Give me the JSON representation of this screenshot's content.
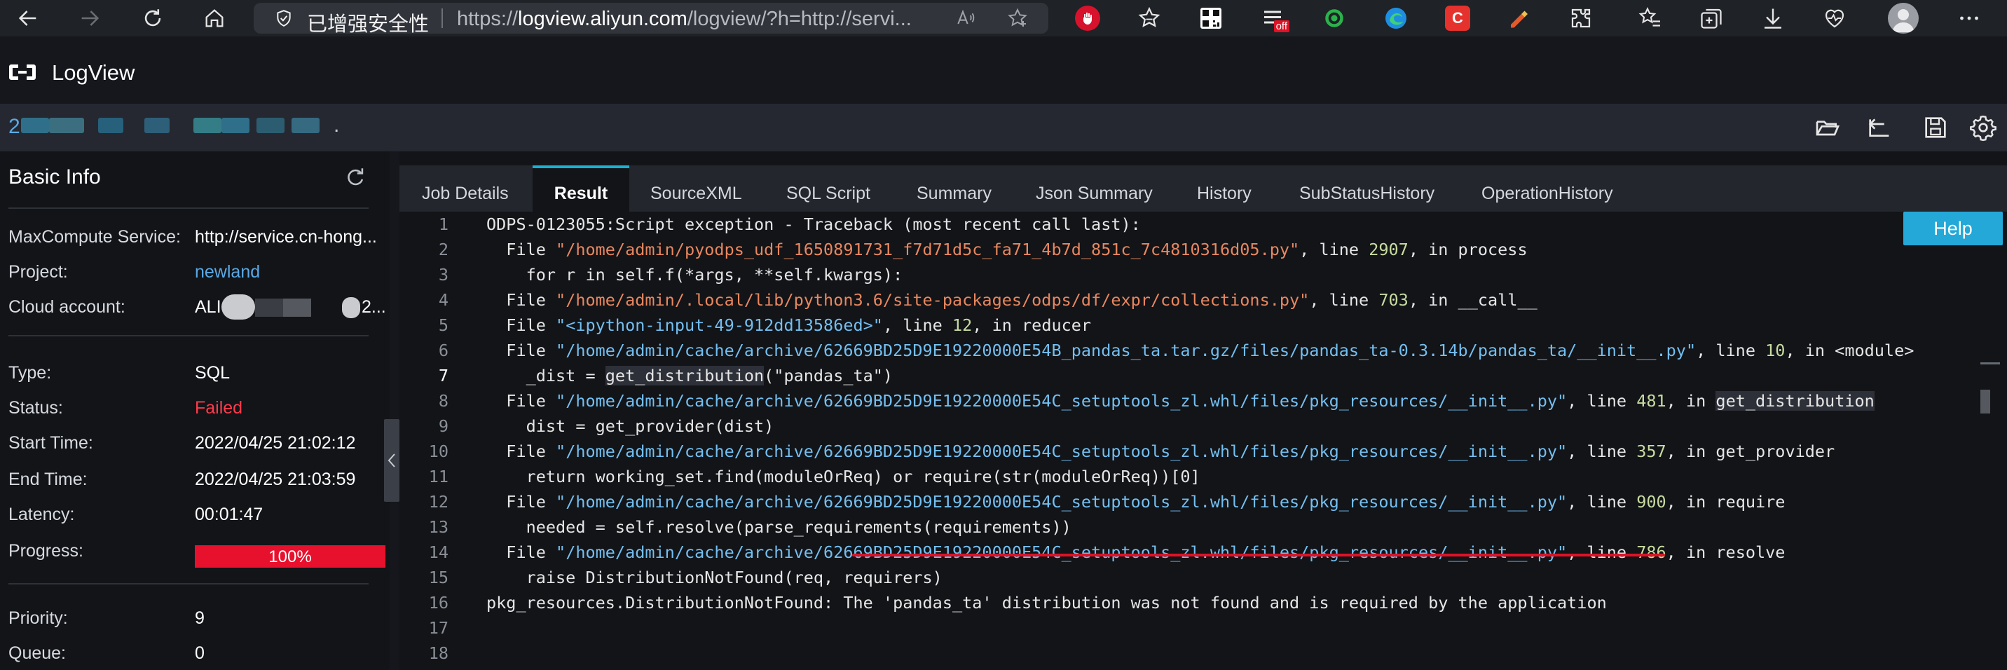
{
  "browser": {
    "security_label": "已增强安全性",
    "url_prefix": "https://",
    "url_domain": "logview.aliyun.com",
    "url_rest": "/logview/?h=http://servi...",
    "ext_badge": "off",
    "ext_c_label": "C"
  },
  "app": {
    "title": "LogView"
  },
  "job": {
    "id_first_char": "2",
    "id_trailing": "."
  },
  "basic_info": {
    "title": "Basic Info",
    "rows": [
      {
        "label": "MaxCompute Service:",
        "value": "http://service.cn-hong..."
      },
      {
        "label": "Project:",
        "value": "newland"
      },
      {
        "label": "Cloud account:",
        "value_prefix": "ALI",
        "value_suffix": "2..."
      },
      {
        "label": "Type:",
        "value": "SQL"
      },
      {
        "label": "Status:",
        "value": "Failed"
      },
      {
        "label": "Start Time:",
        "value": "2022/04/25 21:02:12"
      },
      {
        "label": "End Time:",
        "value": "2022/04/25 21:03:59"
      },
      {
        "label": "Latency:",
        "value": "00:01:47"
      },
      {
        "label": "Progress:",
        "value": "100%"
      },
      {
        "label": "Priority:",
        "value": "9"
      },
      {
        "label": "Queue:",
        "value": "0"
      }
    ],
    "progress": 1.0,
    "colors": {
      "link": "#5aa9e6",
      "failed": "#ff3b4a",
      "progress": "#e8112d"
    }
  },
  "tabs": [
    {
      "label": "Job Details",
      "active": false
    },
    {
      "label": "Result",
      "active": true
    },
    {
      "label": "SourceXML",
      "active": false
    },
    {
      "label": "SQL Script",
      "active": false
    },
    {
      "label": "Summary",
      "active": false
    },
    {
      "label": "Json Summary",
      "active": false
    },
    {
      "label": "History",
      "active": false
    },
    {
      "label": "SubStatusHistory",
      "active": false
    },
    {
      "label": "OperationHistory",
      "active": false
    }
  ],
  "help_label": "Help",
  "result": {
    "current_line": 7,
    "lines": [
      {
        "n": "1",
        "segs": [
          [
            "ODPS-0123055:Script exception - Traceback (most recent call last):",
            ""
          ]
        ]
      },
      {
        "n": "2",
        "segs": [
          [
            "  File ",
            ""
          ],
          [
            "\"/home/admin/pyodps_udf_1650891731_f7d71d5c_fa71_4b7d_851c_7c4810316d05.py\"",
            "s-orange"
          ],
          [
            ", line ",
            ""
          ],
          [
            "2907",
            "s-num"
          ],
          [
            ", in process",
            ""
          ]
        ]
      },
      {
        "n": "3",
        "segs": [
          [
            "    for r in self.f(*args, **self.kwargs):",
            ""
          ]
        ]
      },
      {
        "n": "4",
        "segs": [
          [
            "  File ",
            ""
          ],
          [
            "\"/home/admin/.local/lib/python3.6/site-packages/odps/df/expr/collections.py\"",
            "s-orange"
          ],
          [
            ", line ",
            ""
          ],
          [
            "703",
            "s-num"
          ],
          [
            ", in __call__",
            ""
          ]
        ]
      },
      {
        "n": "5",
        "segs": [
          [
            "  File ",
            ""
          ],
          [
            "\"<ipython-input-49-912dd13586ed>\"",
            "s-blue"
          ],
          [
            ", line ",
            ""
          ],
          [
            "12",
            "s-num"
          ],
          [
            ", in reducer",
            ""
          ]
        ]
      },
      {
        "n": "6",
        "segs": [
          [
            "  File ",
            ""
          ],
          [
            "\"/home/admin/cache/archive/62669BD25D9E19220000E54B_pandas_ta.tar.gz/files/pandas_ta-0.3.14b/pandas_ta/__init__.py\"",
            "s-blue"
          ],
          [
            ", line ",
            ""
          ],
          [
            "10",
            "s-num"
          ],
          [
            ", in <module>",
            ""
          ]
        ]
      },
      {
        "n": "7",
        "segs": [
          [
            "    _dist = ",
            ""
          ],
          [
            "get_distribution",
            "hl"
          ],
          [
            "(\"pandas_ta\")",
            ""
          ]
        ]
      },
      {
        "n": "8",
        "segs": [
          [
            "  File ",
            ""
          ],
          [
            "\"/home/admin/cache/archive/62669BD25D9E19220000E54C_setuptools_zl.whl/files/pkg_resources/__init__.py\"",
            "s-blue"
          ],
          [
            ", line ",
            ""
          ],
          [
            "481",
            "s-num"
          ],
          [
            ", in ",
            ""
          ],
          [
            "get_distribution",
            "hl"
          ]
        ]
      },
      {
        "n": "9",
        "segs": [
          [
            "    dist = get_provider(dist)",
            ""
          ]
        ]
      },
      {
        "n": "10",
        "segs": [
          [
            "  File ",
            ""
          ],
          [
            "\"/home/admin/cache/archive/62669BD25D9E19220000E54C_setuptools_zl.whl/files/pkg_resources/__init__.py\"",
            "s-blue"
          ],
          [
            ", line ",
            ""
          ],
          [
            "357",
            "s-num"
          ],
          [
            ", in get_provider",
            ""
          ]
        ]
      },
      {
        "n": "11",
        "segs": [
          [
            "    return working_set.find(moduleOrReq) or require(str(moduleOrReq))[0]",
            ""
          ]
        ]
      },
      {
        "n": "12",
        "segs": [
          [
            "  File ",
            ""
          ],
          [
            "\"/home/admin/cache/archive/62669BD25D9E19220000E54C_setuptools_zl.whl/files/pkg_resources/__init__.py\"",
            "s-blue"
          ],
          [
            ", line ",
            ""
          ],
          [
            "900",
            "s-num"
          ],
          [
            ", in require",
            ""
          ]
        ]
      },
      {
        "n": "13",
        "segs": [
          [
            "    needed = self.resolve(parse_requirements(requirements))",
            ""
          ]
        ]
      },
      {
        "n": "14",
        "segs": [
          [
            "  File ",
            ""
          ],
          [
            "\"/home/admin/cache/archive/62669BD25D9E19220000E54C_setuptools_zl.whl/files/pkg_resources/__init__.py\"",
            "s-blue"
          ],
          [
            ", line ",
            ""
          ],
          [
            "786",
            "s-num"
          ],
          [
            ", in resolve",
            ""
          ]
        ]
      },
      {
        "n": "15",
        "segs": [
          [
            "    raise DistributionNotFound(req, requirers)",
            ""
          ]
        ]
      },
      {
        "n": "16",
        "segs": [
          [
            "pkg_resources.DistributionNotFound: The 'pandas_ta' distribution was not found and is required by the application",
            ""
          ]
        ]
      },
      {
        "n": "17",
        "segs": []
      },
      {
        "n": "18",
        "segs": []
      }
    ]
  }
}
